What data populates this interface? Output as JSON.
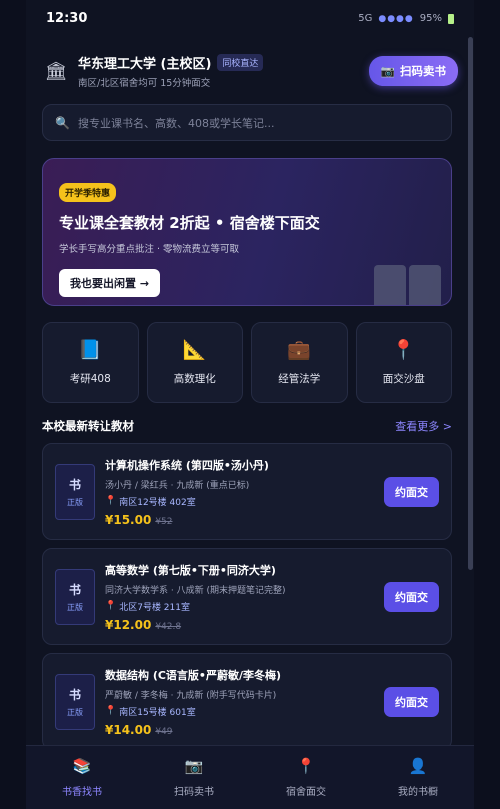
{
  "status_bar": {
    "time": "12:30",
    "network": "5G",
    "signal": "●●●●",
    "battery": "95%"
  },
  "header": {
    "campus_name": "华东理工大学 (主校区)",
    "badge": "同校直达",
    "subtitle": "南区/北区宿舍均可 15分钟面交",
    "scan_button": "扫码卖书"
  },
  "search": {
    "placeholder": "搜专业课书名、高数、408或学长笔记..."
  },
  "banner": {
    "tag": "开学季特惠",
    "title": "专业课全套教材 2折起 • 宿舍楼下面交",
    "subtitle": "学长手写高分重点批注 · 零物流费立等可取",
    "button": "我也要出闲置 →"
  },
  "categories": [
    {
      "label": "考研408",
      "icon": "book-icon"
    },
    {
      "label": "高数理化",
      "icon": "ruler-icon"
    },
    {
      "label": "经管法学",
      "icon": "briefcase-icon"
    },
    {
      "label": "面交沙盘",
      "icon": "pin-icon"
    }
  ],
  "section": {
    "title": "本校最新转让教材",
    "more": "查看更多 >"
  },
  "books": [
    {
      "cover_char": "书",
      "cover_label": "正版",
      "title": "计算机操作系统 (第四版•汤小丹)",
      "meta": "汤小丹 / 梁红兵 · 九成新 (重点已标)",
      "location": "南区12号楼 402室",
      "price": "¥15.00",
      "old_price": "¥52",
      "button": "约面交"
    },
    {
      "cover_char": "书",
      "cover_label": "正版",
      "title": "高等数学 (第七版•下册•同济大学)",
      "meta": "同济大学数学系 · 八成新 (期末押题笔记完整)",
      "location": "北区7号楼 211室",
      "price": "¥12.00",
      "old_price": "¥42.8",
      "button": "约面交"
    },
    {
      "cover_char": "书",
      "cover_label": "正版",
      "title": "数据结构 (C语言版•严蔚敏/李冬梅)",
      "meta": "严蔚敏 / 李冬梅 · 九成新 (附手写代码卡片)",
      "location": "南区15号楼 601室",
      "price": "¥14.00",
      "old_price": "¥49",
      "button": "约面交"
    }
  ],
  "tabs": [
    {
      "label": "书香找书",
      "icon": "books-icon",
      "active": true
    },
    {
      "label": "扫码卖书",
      "icon": "camera-icon",
      "active": false
    },
    {
      "label": "宿舍面交",
      "icon": "pin-icon",
      "active": false
    },
    {
      "label": "我的书橱",
      "icon": "user-icon",
      "active": false
    }
  ],
  "colors": {
    "accent": "#5b4fe6",
    "price": "#f5c21b",
    "background": "#0f1322"
  }
}
